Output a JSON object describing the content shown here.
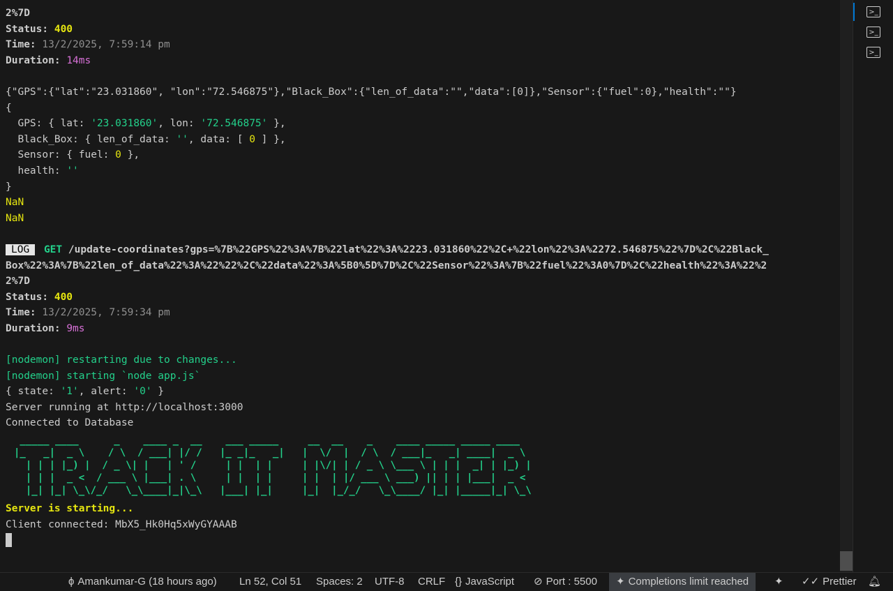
{
  "terminal": {
    "block1": {
      "url_tail": "2%7D",
      "status_label": "Status: ",
      "status_value": "400",
      "time_label": "Time: ",
      "time_value": "13/2/2025, 7:59:14 pm",
      "duration_label": "Duration: ",
      "duration_value": "14ms"
    },
    "json_raw": "{\"GPS\":{\"lat\":\"23.031860\", \"lon\":\"72.546875\"},\"Black_Box\":{\"len_of_data\":\"\",\"data\":[0]},\"Sensor\":{\"fuel\":0},\"health\":\"\"}",
    "obj": {
      "open": "{",
      "gps_prefix": "  GPS: { lat: ",
      "gps_lat": "'23.031860'",
      "gps_mid": ", lon: ",
      "gps_lon": "'72.546875'",
      "gps_suffix": " },",
      "bb_prefix": "  Black_Box: { len_of_data: ",
      "bb_len": "''",
      "bb_mid": ", data: [ ",
      "bb_data": "0",
      "bb_suffix": " ] },",
      "sensor_prefix": "  Sensor: { fuel: ",
      "sensor_fuel": "0",
      "sensor_suffix": " },",
      "health_prefix": "  health: ",
      "health_value": "''",
      "close": "}"
    },
    "nan1": "NaN",
    "nan2": "NaN",
    "block2": {
      "log_tag": "LOG",
      "method": "GET",
      "url_line1": "/update-coordinates?gps=%7B%22GPS%22%3A%7B%22lat%22%3A%2223.031860%22%2C+%22lon%22%3A%2272.546875%22%7D%2C%22Black_",
      "url_line2": "Box%22%3A%7B%22len_of_data%22%3A%22%22%2C%22data%22%3A%5B0%5D%7D%2C%22Sensor%22%3A%7B%22fuel%22%3A0%7D%2C%22health%22%3A%22%2",
      "url_line3": "2%7D",
      "status_label": "Status: ",
      "status_value": "400",
      "time_label": "Time: ",
      "time_value": "13/2/2025, 7:59:34 pm",
      "duration_label": "Duration: ",
      "duration_value": "9ms"
    },
    "nodemon_restart": "[nodemon] restarting due to changes...",
    "nodemon_start": "[nodemon] starting `node app.js`",
    "state": {
      "prefix": "{ state: ",
      "state_value": "'1'",
      "mid": ", alert: ",
      "alert_value": "'0'",
      "suffix": " }"
    },
    "server_running": "Server running at http://localhost:3000",
    "db_connected": "Connected to Database",
    "banner": " _____ ____      _    ____ _  __    ___ _____     __  __    _    ____ _____ _____ ____  \n|_   _|  _ \\    / \\  / ___| |/ /   |_ _|_   _|   |  \\/  |  / \\  / ___|_   _| ____|  _ \\ \n  | | | |_) |  / _ \\| |   | ' /     | |  | |     | |\\/| | / _ \\ \\___ \\ | | |  _| | |_) |\n  | | |  _ <  / ___ \\ |___| . \\     | |  | |     | |  | |/ ___ \\ ___) || | | |___|  _ < \n  |_| |_| \\_\\/_/   \\_\\____|_|\\_\\   |___| |_|     |_|  |_/_/   \\_\\____/ |_| |_____|_| \\_\\",
    "server_starting": "Server is starting...",
    "client_connected": "Client connected: MbX5_Hk0Hq5xWyGYAAAB"
  },
  "side_tabs": [
    {
      "icon": "terminal-icon",
      "active": true
    },
    {
      "icon": "terminal-icon",
      "active": false
    },
    {
      "icon": "terminal-icon",
      "active": false
    }
  ],
  "statusbar": {
    "git": "Amankumar-G (18 hours ago)",
    "position": "Ln 52, Col 51",
    "spaces": "Spaces: 2",
    "encoding": "UTF-8",
    "eol": "CRLF",
    "lang_icon": "{}",
    "language": "JavaScript",
    "port": "Port : 5500",
    "completions": "Completions limit reached",
    "prettier": "Prettier"
  },
  "colors": {
    "background": "#181818",
    "text": "#cccccc",
    "yellow": "#e5e510",
    "magenta": "#d670d6",
    "green": "#23d18b"
  }
}
